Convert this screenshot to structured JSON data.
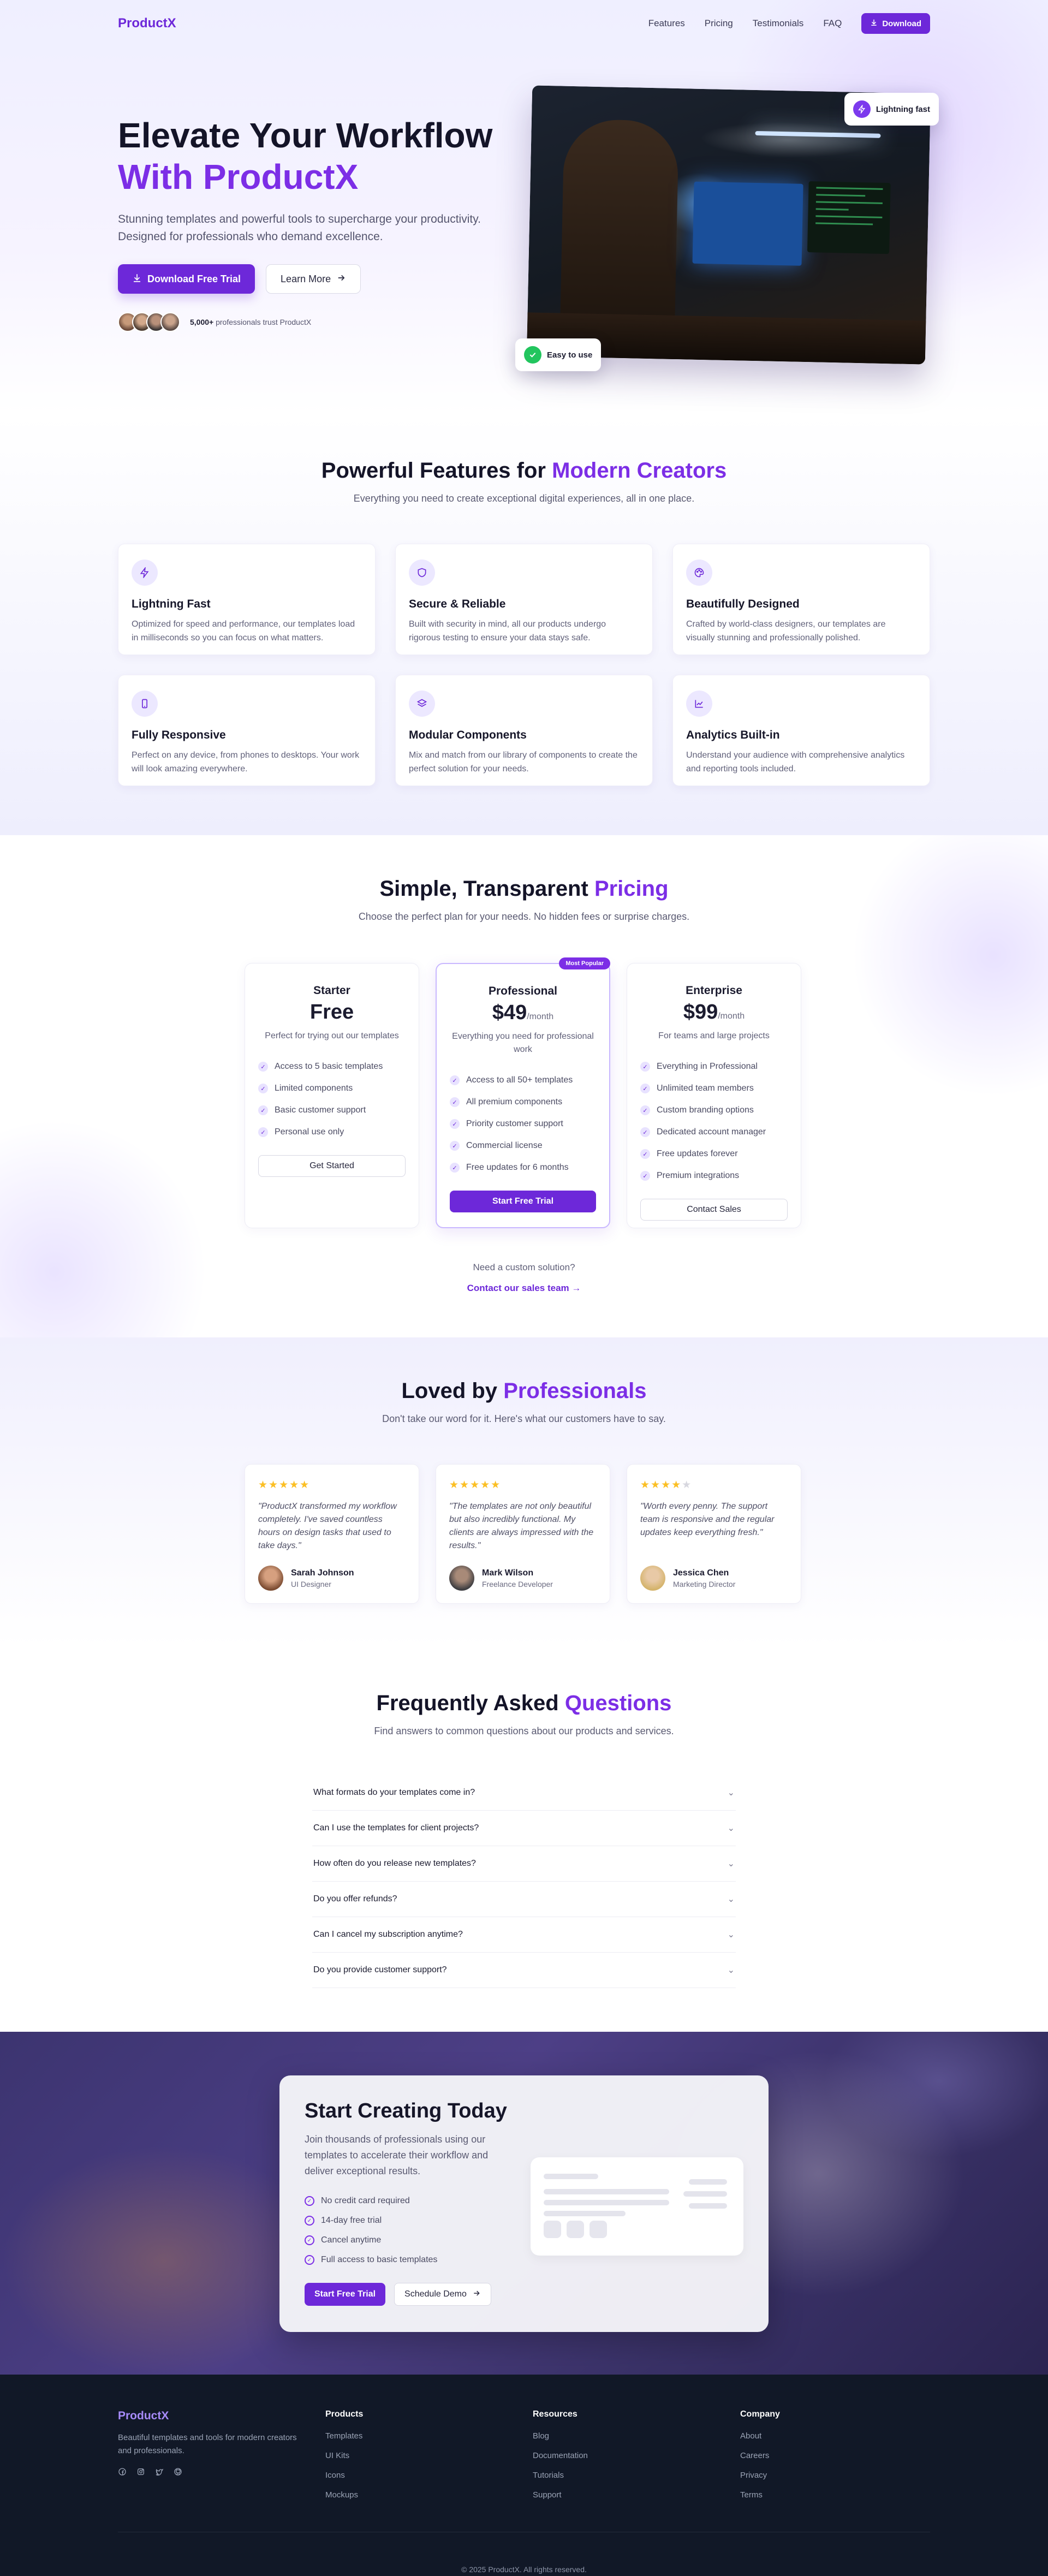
{
  "brand": {
    "name": "ProductX",
    "accent": "#6d28d9",
    "accent_light": "#7c2ee6"
  },
  "nav": {
    "links": [
      "Features",
      "Pricing",
      "Testimonials",
      "FAQ"
    ],
    "download_label": "Download",
    "download_icon": "download-icon"
  },
  "hero": {
    "title_line1": "Elevate Your Workflow",
    "title_line2": "With ProductX",
    "subtitle": "Stunning templates and powerful tools to supercharge your productivity. Designed for professionals who demand excellence.",
    "primary_cta": "Download Free Trial",
    "secondary_cta": "Learn More",
    "trust_count": "5,000+",
    "trust_text": "professionals trust ProductX",
    "badge_top": "Lightning fast",
    "badge_bottom": "Easy to use"
  },
  "features": {
    "title_plain": "Powerful Features for",
    "title_accent": "Modern Creators",
    "subtitle": "Everything you need to create exceptional digital experiences, all in one place.",
    "items": [
      {
        "icon": "bolt-icon",
        "title": "Lightning Fast",
        "desc": "Optimized for speed and performance, our templates load in milliseconds so you can focus on what matters."
      },
      {
        "icon": "shield-icon",
        "title": "Secure & Reliable",
        "desc": "Built with security in mind, all our products undergo rigorous testing to ensure your data stays safe."
      },
      {
        "icon": "palette-icon",
        "title": "Beautifully Designed",
        "desc": "Crafted by world-class designers, our templates are visually stunning and professionally polished."
      },
      {
        "icon": "mobile-icon",
        "title": "Fully Responsive",
        "desc": "Perfect on any device, from phones to desktops. Your work will look amazing everywhere."
      },
      {
        "icon": "layers-icon",
        "title": "Modular Components",
        "desc": "Mix and match from our library of components to create the perfect solution for your needs."
      },
      {
        "icon": "chart-icon",
        "title": "Analytics Built-in",
        "desc": "Understand your audience with comprehensive analytics and reporting tools included."
      }
    ]
  },
  "pricing": {
    "title_plain": "Simple, Transparent",
    "title_accent": "Pricing",
    "subtitle": "Choose the perfect plan for your needs. No hidden fees or surprise charges.",
    "popular_badge": "Most Popular",
    "plans": [
      {
        "name": "Starter",
        "price": "Free",
        "period": "",
        "desc": "Perfect for trying out our templates",
        "features": [
          "Access to 5 basic templates",
          "Limited components",
          "Basic customer support",
          "Personal use only"
        ],
        "cta": "Get Started"
      },
      {
        "name": "Professional",
        "price": "$49",
        "period": "/month",
        "desc": "Everything you need for professional work",
        "features": [
          "Access to all 50+ templates",
          "All premium components",
          "Priority customer support",
          "Commercial license",
          "Free updates for 6 months"
        ],
        "cta": "Start Free Trial"
      },
      {
        "name": "Enterprise",
        "price": "$99",
        "period": "/month",
        "desc": "For teams and large projects",
        "features": [
          "Everything in Professional",
          "Unlimited team members",
          "Custom branding options",
          "Dedicated account manager",
          "Free updates forever",
          "Premium integrations"
        ],
        "cta": "Contact Sales"
      }
    ],
    "custom_q": "Need a custom solution?",
    "custom_link": "Contact our sales team →"
  },
  "testimonials": {
    "title_plain": "Loved by",
    "title_accent": "Professionals",
    "subtitle": "Don't take our word for it. Here's what our customers have to say.",
    "items": [
      {
        "stars": 5,
        "quote": "\"ProductX transformed my workflow completely. I've saved countless hours on design tasks that used to take days.\"",
        "name": "Sarah Johnson",
        "role": "UI Designer"
      },
      {
        "stars": 5,
        "quote": "\"The templates are not only beautiful but also incredibly functional. My clients are always impressed with the results.\"",
        "name": "Mark Wilson",
        "role": "Freelance Developer"
      },
      {
        "stars": 4,
        "quote": "\"Worth every penny. The support team is responsive and the regular updates keep everything fresh.\"",
        "name": "Jessica Chen",
        "role": "Marketing Director"
      }
    ]
  },
  "faq": {
    "title_plain": "Frequently Asked",
    "title_accent": "Questions",
    "subtitle": "Find answers to common questions about our products and services.",
    "items": [
      "What formats do your templates come in?",
      "Can I use the templates for client projects?",
      "How often do you release new templates?",
      "Do you offer refunds?",
      "Can I cancel my subscription anytime?",
      "Do you provide customer support?"
    ]
  },
  "cta": {
    "title": "Start Creating Today",
    "desc": "Join thousands of professionals using our templates to accelerate their workflow and deliver exceptional results.",
    "list": [
      "No credit card required",
      "14-day free trial",
      "Cancel anytime",
      "Full access to basic templates"
    ],
    "primary": "Start Free Trial",
    "secondary": "Schedule Demo"
  },
  "footer": {
    "about": "Beautiful templates and tools for modern creators and professionals.",
    "social_icons": [
      "facebook-icon",
      "instagram-icon",
      "twitter-icon",
      "github-icon"
    ],
    "cols": [
      {
        "head": "Products",
        "links": [
          "Templates",
          "UI Kits",
          "Icons",
          "Mockups"
        ]
      },
      {
        "head": "Resources",
        "links": [
          "Blog",
          "Documentation",
          "Tutorials",
          "Support"
        ]
      },
      {
        "head": "Company",
        "links": [
          "About",
          "Careers",
          "Privacy",
          "Terms"
        ]
      }
    ],
    "copyright": "© 2025 ProductX. All rights reserved."
  }
}
